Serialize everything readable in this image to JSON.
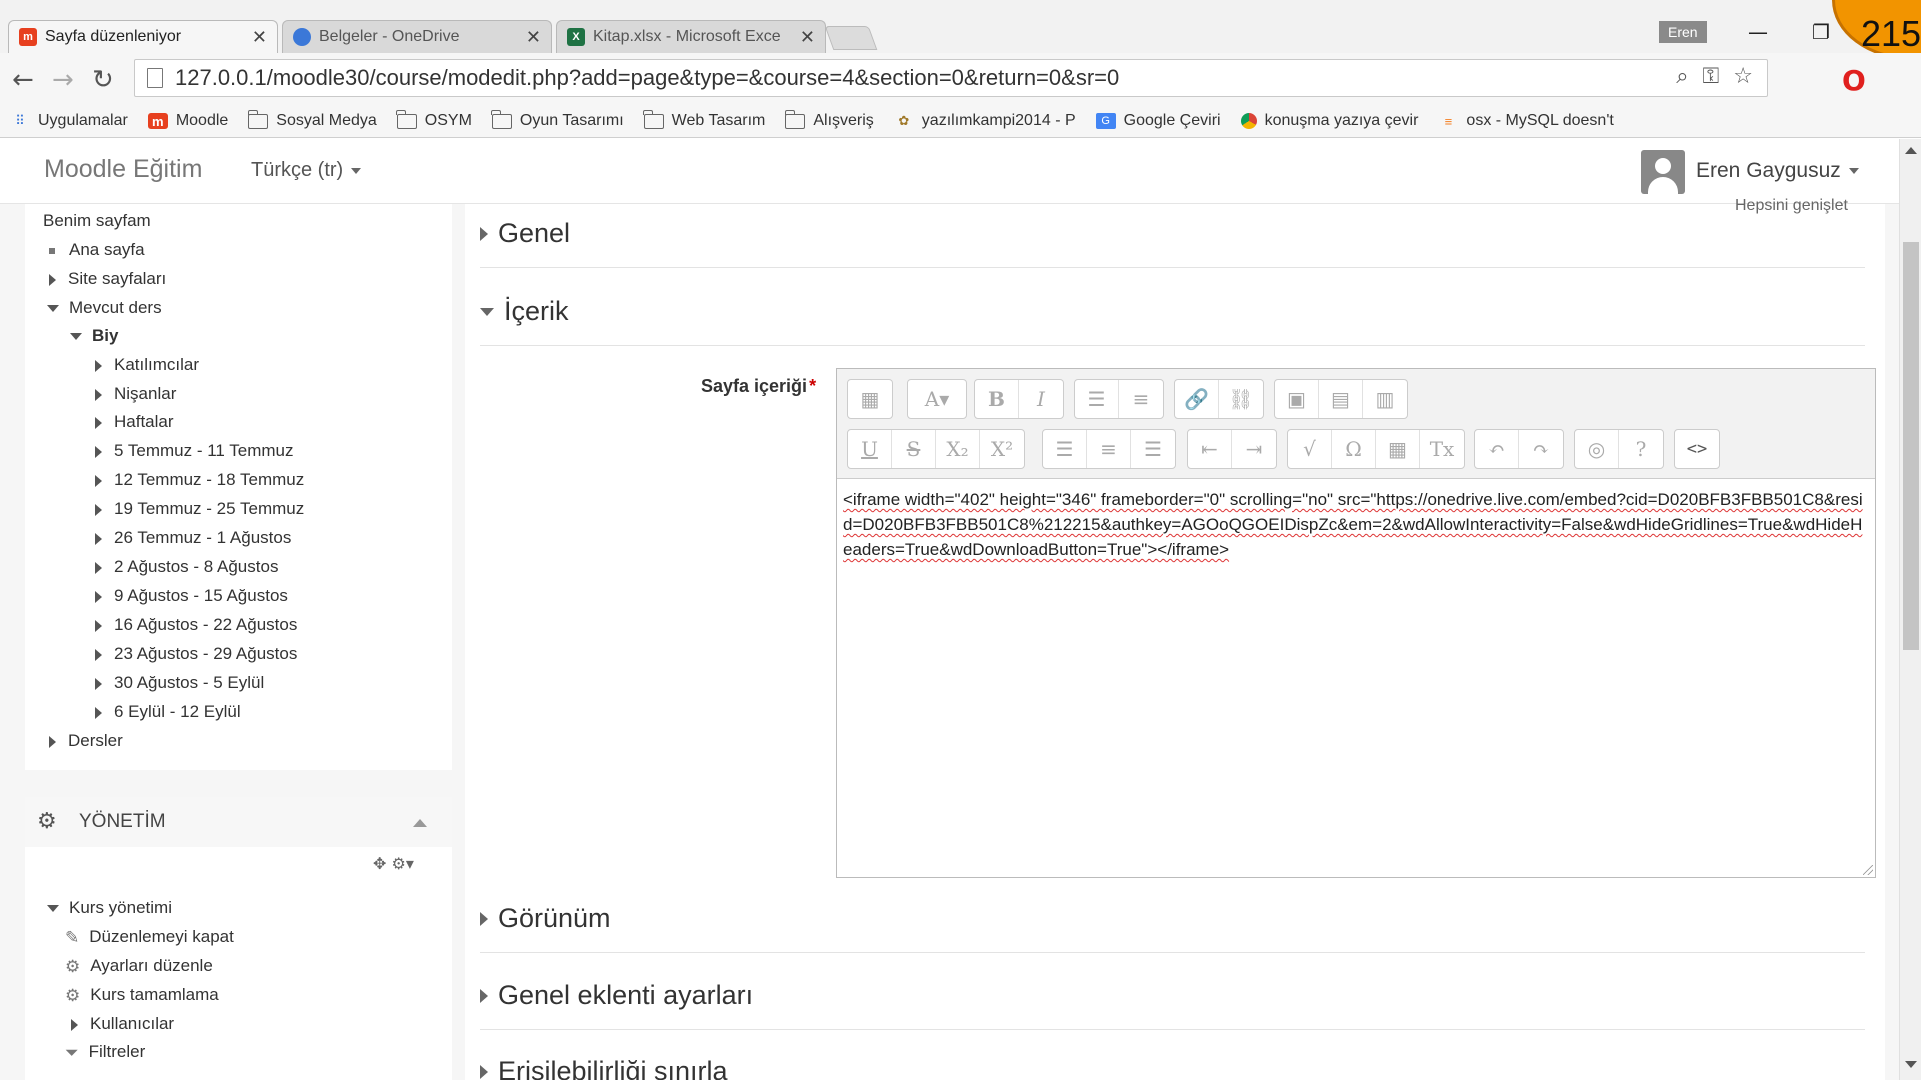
{
  "browser": {
    "tabs": [
      {
        "title": "Sayfa düzenleniyor",
        "icon": "moodle-icon",
        "active": true
      },
      {
        "title": "Belgeler - OneDrive",
        "icon": "onedrive-icon",
        "active": false
      },
      {
        "title": "Kitap.xlsx - Microsoft Exce",
        "icon": "excel-icon",
        "active": false
      }
    ],
    "close_glyph": "✕",
    "profile_name": "Eren",
    "url": "127.0.0.1/moodle30/course/modedit.php?add=page&type=&course=4&section=0&return=0&sr=0",
    "bookmarks": [
      {
        "label": "Uygulamalar",
        "icon": "apps-grid-icon"
      },
      {
        "label": "Moodle",
        "icon": "moodle-icon"
      },
      {
        "label": "Sosyal Medya",
        "icon": "folder-icon"
      },
      {
        "label": "OSYM",
        "icon": "folder-icon"
      },
      {
        "label": "Oyun Tasarımı",
        "icon": "folder-icon"
      },
      {
        "label": "Web Tasarım",
        "icon": "folder-icon"
      },
      {
        "label": "Alışveriş",
        "icon": "folder-icon"
      },
      {
        "label": "yazılımkampi2014 - P",
        "icon": "site-icon"
      },
      {
        "label": "Google Çeviri",
        "icon": "translate-icon"
      },
      {
        "label": "konuşma yazıya çevir",
        "icon": "chrome-icon"
      },
      {
        "label": "osx - MySQL doesn't",
        "icon": "stackoverflow-icon"
      }
    ],
    "corner_number": "215"
  },
  "header": {
    "brand": "Moodle Eğitim",
    "language": "Türkçe (tr)",
    "user_name": "Eren Gaygusuz"
  },
  "nav": {
    "items": [
      {
        "label": "Benim sayfam",
        "level": 0,
        "marker": "none"
      },
      {
        "label": "Ana sayfa",
        "level": 1,
        "marker": "square"
      },
      {
        "label": "Site sayfaları",
        "level": 1,
        "marker": "collapsed"
      },
      {
        "label": "Mevcut ders",
        "level": 1,
        "marker": "expanded"
      },
      {
        "label": "Biy",
        "level": 2,
        "marker": "expanded"
      },
      {
        "label": "Katılımcılar",
        "level": 3,
        "marker": "collapsed"
      },
      {
        "label": "Nişanlar",
        "level": 3,
        "marker": "collapsed"
      },
      {
        "label": "Haftalar",
        "level": 3,
        "marker": "collapsed"
      },
      {
        "label": "5 Temmuz - 11 Temmuz",
        "level": 3,
        "marker": "collapsed"
      },
      {
        "label": "12 Temmuz - 18 Temmuz",
        "level": 3,
        "marker": "collapsed"
      },
      {
        "label": "19 Temmuz - 25 Temmuz",
        "level": 3,
        "marker": "collapsed"
      },
      {
        "label": "26 Temmuz - 1 Ağustos",
        "level": 3,
        "marker": "collapsed"
      },
      {
        "label": "2 Ağustos - 8 Ağustos",
        "level": 3,
        "marker": "collapsed"
      },
      {
        "label": "9 Ağustos - 15 Ağustos",
        "level": 3,
        "marker": "collapsed"
      },
      {
        "label": "16 Ağustos - 22 Ağustos",
        "level": 3,
        "marker": "collapsed"
      },
      {
        "label": "23 Ağustos - 29 Ağustos",
        "level": 3,
        "marker": "collapsed"
      },
      {
        "label": "30 Ağustos - 5 Eylül",
        "level": 3,
        "marker": "collapsed"
      },
      {
        "label": "6 Eylül - 12 Eylül",
        "level": 3,
        "marker": "collapsed"
      },
      {
        "label": "Dersler",
        "level": 1,
        "marker": "collapsed"
      }
    ]
  },
  "admin": {
    "title": "YÖNETİM",
    "items": [
      {
        "label": "Kurs yönetimi",
        "icon": "expanded",
        "level": 0
      },
      {
        "label": "Düzenlemeyi kapat",
        "icon": "pencil-icon",
        "level": 1
      },
      {
        "label": "Ayarları düzenle",
        "icon": "gear-icon",
        "level": 1
      },
      {
        "label": "Kurs tamamlama",
        "icon": "gear-icon",
        "level": 1
      },
      {
        "label": "Kullanıcılar",
        "icon": "collapsed",
        "level": 1
      },
      {
        "label": "Filtreler",
        "icon": "filter-icon",
        "level": 1
      }
    ]
  },
  "main": {
    "partial_top_text": "Hepsini genişlet",
    "sections": [
      {
        "title": "Genel",
        "expanded": false
      },
      {
        "title": "İçerik",
        "expanded": true
      },
      {
        "title": "Görünüm",
        "expanded": false
      },
      {
        "title": "Genel eklenti ayarları",
        "expanded": false
      },
      {
        "title": "Erişilebilirliği sınırla",
        "expanded": false
      }
    ],
    "content_label": "Sayfa içeriği",
    "required_mark": "*",
    "editor_toolbar": {
      "row1": [
        [
          "toolbar-toggle-icon"
        ],
        [
          "style-icon"
        ],
        [
          "bold-icon",
          "italic-icon"
        ],
        [
          "unordered-list-icon",
          "ordered-list-icon"
        ],
        [
          "link-icon",
          "unlink-icon"
        ],
        [
          "image-icon",
          "media-icon",
          "manage-files-icon"
        ]
      ],
      "row2": [
        [
          "underline-icon",
          "strikethrough-icon",
          "subscript-icon",
          "superscript-icon"
        ],
        [
          "align-left-icon",
          "align-center-icon",
          "align-right-icon"
        ],
        [
          "outdent-icon",
          "indent-icon"
        ],
        [
          "equation-icon",
          "special-char-icon",
          "table-icon",
          "clear-format-icon"
        ],
        [
          "undo-icon",
          "redo-icon"
        ],
        [
          "accessibility-checker-icon",
          "screenreader-helper-icon"
        ],
        [
          "html-source-icon"
        ]
      ]
    },
    "editor_source": "<iframe width=\"402\" height=\"346\" frameborder=\"0\" scrolling=\"no\" src=\"https://onedrive.live.com/embed?cid=D020BFB3FBB501C8&resid=D020BFB3FBB501C8%212215&authkey=AGOoQGOEIDispZc&em=2&wdAllowInteractivity=False&wdHideGridlines=True&wdHideHeaders=True&wdDownloadButton=True\"></iframe>"
  },
  "colors": {
    "accent_orange": "#f29400",
    "required_red": "#cc0000",
    "moodle_red": "#e7401f"
  }
}
